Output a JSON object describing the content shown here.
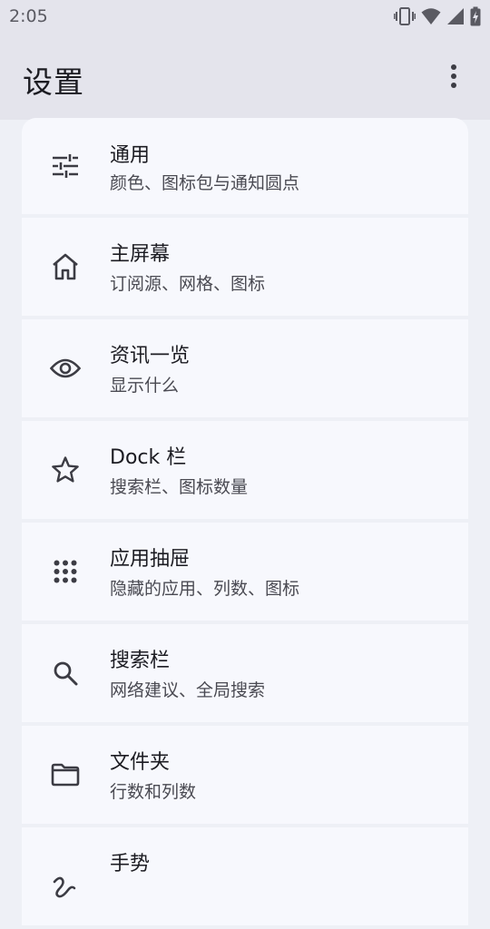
{
  "status_bar": {
    "time": "2:05",
    "icons": [
      "vibrate-icon",
      "wifi-icon",
      "cell-signal-icon",
      "battery-charging-icon"
    ]
  },
  "app_bar": {
    "title": "设置",
    "overflow_icon": "more-vert-icon"
  },
  "settings": [
    {
      "id": "general",
      "icon": "tune-icon",
      "title": "通用",
      "subtitle": "颜色、图标包与通知圆点"
    },
    {
      "id": "home-screen",
      "icon": "home-icon",
      "title": "主屏幕",
      "subtitle": "订阅源、网格、图标"
    },
    {
      "id": "feed",
      "icon": "eye-icon",
      "title": "资讯一览",
      "subtitle": "显示什么"
    },
    {
      "id": "dock",
      "icon": "star-icon",
      "title": "Dock 栏",
      "subtitle": "搜索栏、图标数量"
    },
    {
      "id": "app-drawer",
      "icon": "apps-grid-icon",
      "title": "应用抽屉",
      "subtitle": "隐藏的应用、列数、图标"
    },
    {
      "id": "search-bar",
      "icon": "search-icon",
      "title": "搜索栏",
      "subtitle": "网络建议、全局搜索"
    },
    {
      "id": "folders",
      "icon": "folder-icon",
      "title": "文件夹",
      "subtitle": "行数和列数"
    },
    {
      "id": "gestures",
      "icon": "gesture-icon",
      "title": "手势",
      "subtitle": ""
    }
  ]
}
